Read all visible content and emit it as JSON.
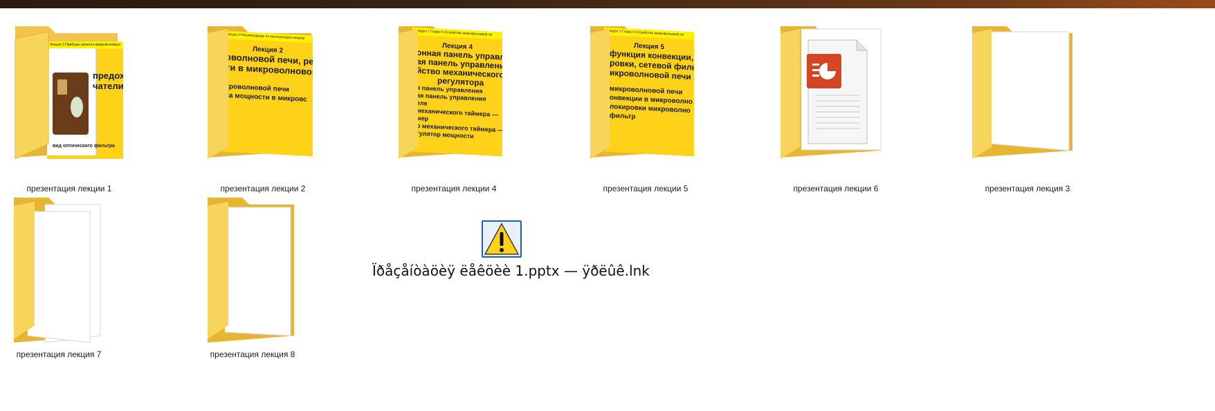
{
  "items": [
    {
      "label": "презентация лекции 1",
      "slide": {
        "bar": "Лекция 3 Приборы ремонта микроволновых",
        "lines": [
          "предохра",
          "чатели"
        ],
        "bottom": "вид оптического фильтра"
      }
    },
    {
      "label": "презентация лекции 2",
      "slide": {
        "bar": "Лекция 2 Рекомендации по эксплуатации микров",
        "heading": "Лекция 2",
        "lines": [
          "оволновой печи, регу",
          "ти в микроволновой п"
        ],
        "sublines": [
          "кроволновой печи",
          "ка мощности в микровс"
        ]
      }
    },
    {
      "label": "презентация лекции 4",
      "slide": {
        "bar": "Раздел 1 Глава 4 Устройство микроволновой пе",
        "heading": "Лекция 4",
        "lines": [
          "онная панель управлен",
          "ая панель управления, п",
          "йство механического та",
          "регулятора"
        ],
        "sublines": [
          "я панель управления",
          "ая панель управления",
          "еле",
          "механического таймера —",
          "мер",
          "о механического таймера —",
          "гулятор        мощности"
        ]
      }
    },
    {
      "label": "презентация лекции 5",
      "slide": {
        "bar": "Раздел 1 Глава 4 Устройство микроволновой пе",
        "heading": "Лекция 5",
        "lines": [
          "функция конвекции, с",
          "ровки, сетевой филь",
          "икроволновой печи"
        ],
        "sublines": [
          "микроволновой печи",
          "онвекции в микроволно",
          "",
          "локировки микроволно",
          "фильтр"
        ]
      }
    },
    {
      "label": "презентация лекции 6"
    },
    {
      "label": "презентация лекция 3"
    },
    {
      "label": "презентация лекция 7"
    },
    {
      "label": "презентация лекция 8"
    }
  ],
  "shortcut": {
    "label": "Ïðåçåíòàöèÿ ëåêöèè 1.pptx — ÿðëûê.lnk",
    "icon": "warning-icon"
  }
}
